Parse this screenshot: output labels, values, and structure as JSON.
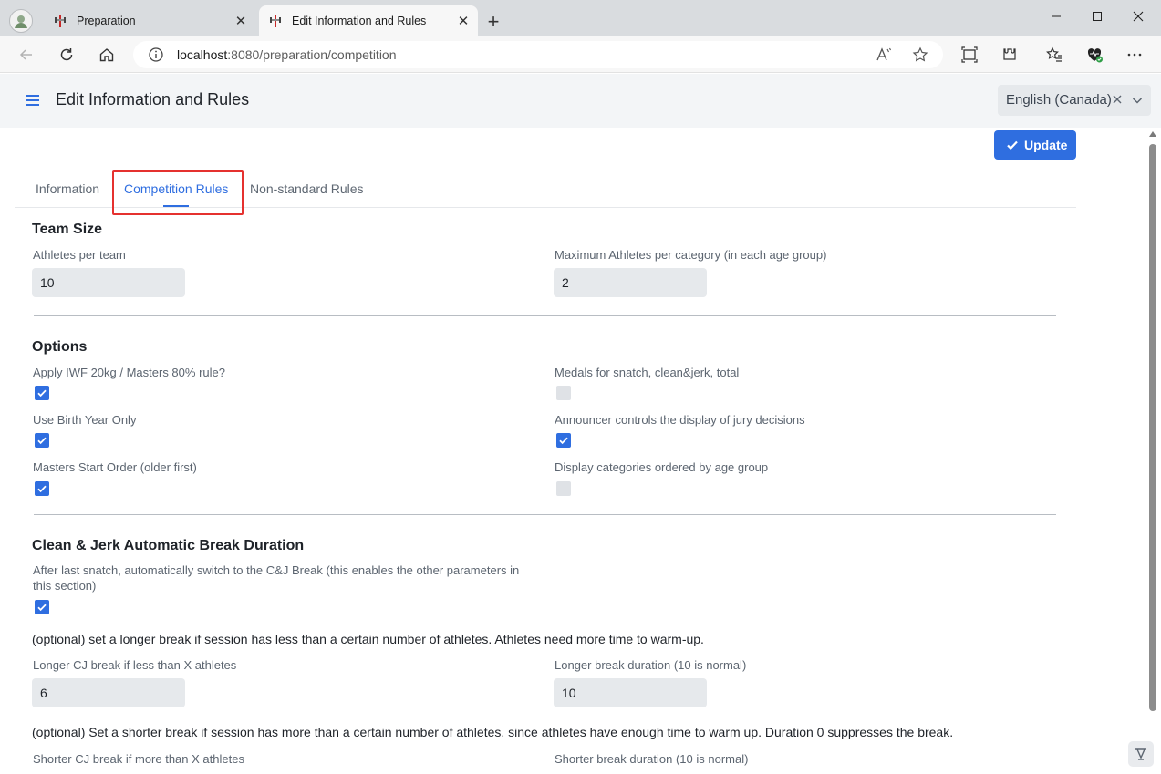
{
  "browser": {
    "tabs": [
      {
        "title": "Preparation",
        "icon": "barbell-favicon-icon"
      },
      {
        "title": "Edit Information and Rules",
        "icon": "barbell-favicon-icon"
      }
    ],
    "url_host": "localhost",
    "url_rest": ":8080/preparation/competition",
    "window_controls": [
      "minimize-icon",
      "maximize-icon",
      "close-icon"
    ]
  },
  "header": {
    "title": "Edit Information and Rules",
    "language": "English (Canada)"
  },
  "toolbar": {
    "update_label": "Update"
  },
  "tabs": {
    "information": "Information",
    "competition_rules": "Competition Rules",
    "non_standard_rules": "Non-standard Rules",
    "selected": "Competition Rules"
  },
  "team_size": {
    "title": "Team Size",
    "athletes_per_team_label": "Athletes per team",
    "athletes_per_team_value": "10",
    "max_athletes_label": "Maximum Athletes per category (in each age group)",
    "max_athletes_value": "2"
  },
  "options": {
    "title": "Options",
    "items": [
      {
        "label": "Apply IWF 20kg / Masters 80% rule?",
        "checked": true
      },
      {
        "label": "Medals for snatch, clean&jerk, total",
        "checked": false
      },
      {
        "label": "Use Birth Year Only",
        "checked": true
      },
      {
        "label": "Announcer controls the display of jury decisions",
        "checked": true
      },
      {
        "label": "Masters Start Order (older first)",
        "checked": true
      },
      {
        "label": "Display categories ordered by age group",
        "checked": false
      }
    ]
  },
  "cj_break": {
    "title": "Clean & Jerk Automatic Break Duration",
    "auto_switch_label": "After last snatch, automatically switch to the C&J Break (this enables the other parameters in this section)",
    "auto_switch_checked": true,
    "longer_note": "(optional) set a longer break if session has less than a certain number of athletes. Athletes need more time to warm-up.",
    "longer_threshold_label": "Longer CJ break if less than X athletes",
    "longer_threshold_value": "6",
    "longer_duration_label": "Longer break duration (10 is normal)",
    "longer_duration_value": "10",
    "shorter_note": "(optional) Set a shorter break if session has more than a certain number of athletes, since athletes have enough time to warm up. Duration 0 suppresses the break.",
    "shorter_threshold_label": "Shorter CJ break if more than X athletes",
    "shorter_duration_label": "Shorter break duration (10 is normal)"
  },
  "colors": {
    "accent": "#2f6ee0",
    "highlight": "#e5312f",
    "field_bg": "#e6e9ec"
  }
}
